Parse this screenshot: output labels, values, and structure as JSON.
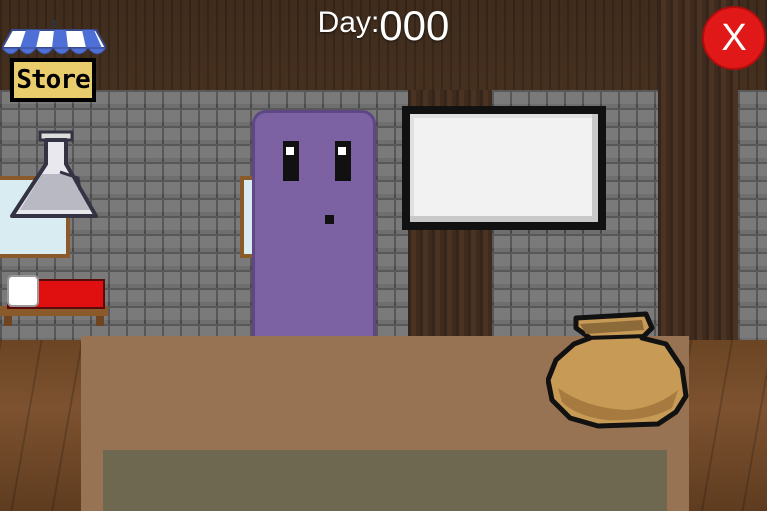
{
  "hud": {
    "day_label": "Day:",
    "day_value": "000",
    "close_label": "X"
  },
  "menu": {
    "store_label": "Store"
  },
  "colors": {
    "close_button": "#e01818",
    "customer": "#7c62a3",
    "counter": "#977354",
    "bed_blanket": "#e01010",
    "store_sign": "#e9cd6d"
  },
  "icons": [
    "store-awning-icon",
    "potion-flask-icon",
    "bed-icon",
    "close-icon",
    "bag-icon"
  ]
}
